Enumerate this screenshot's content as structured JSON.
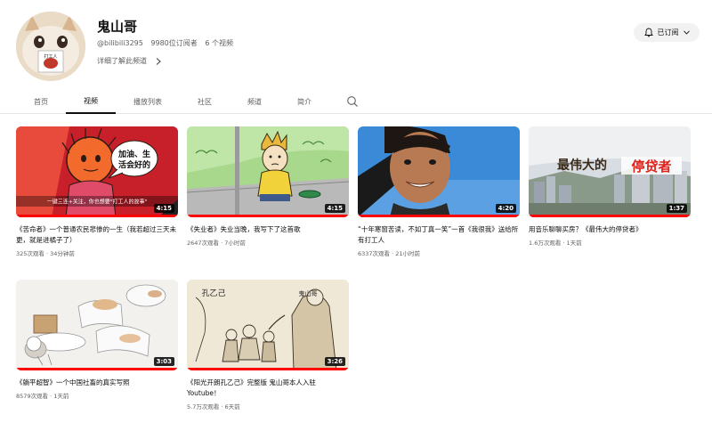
{
  "channel": {
    "name": "鬼山哥",
    "handle": "@bilibili3295",
    "subscribers": "9980位订阅者",
    "video_count": "6 个视频",
    "more_link": "详细了解此频道",
    "subscribe_label": "已订阅",
    "avatar_text": "打工人"
  },
  "tabs": [
    {
      "label": "首页"
    },
    {
      "label": "视频"
    },
    {
      "label": "播放列表"
    },
    {
      "label": "社区"
    },
    {
      "label": "频道"
    },
    {
      "label": "简介"
    }
  ],
  "videos": [
    {
      "title": "《苦命者》一个普通农民悲惨的一生（我若超过三天未更，就是进橘子了）",
      "meta": "325次观看 · 34分钟前",
      "duration": "4:15",
      "progress": 1.0,
      "overlay": {
        "bubble": "加油、生活会好的",
        "caption": "一键三连+关注，你也想要“打工人的故事”"
      }
    },
    {
      "title": "《失业者》失业当晚，我写下了这首歌",
      "meta": "2647次观看 · 7小时前",
      "duration": "4:15",
      "progress": 1.0
    },
    {
      "title": "“十年寒窗苦读，不如丁真一笑”一首《我很我》送给所有打工人",
      "meta": "6337次观看 · 21小时前",
      "duration": "4:20",
      "progress": 1.0
    },
    {
      "title": "用音乐聊聊买房？《最伟大的停贷者》",
      "meta": "1.6万次观看 · 1天前",
      "duration": "1:37",
      "progress": 1.0,
      "overlay": {
        "text_left": "最伟大的",
        "text_right": "停贷者"
      }
    },
    {
      "title": "《躺平超智》一个中国社畜的真实写照",
      "meta": "8579次观看 · 1天前",
      "duration": "3:03",
      "progress": 1.0
    },
    {
      "title": "《阳光开朗孔乙己》完整版 鬼山哥本人入驻Youtube！",
      "meta": "5.7万次观看 · 6天前",
      "duration": "3:26",
      "progress": 1.0,
      "overlay": {
        "text": "孔乙己",
        "author": "鬼山哥"
      }
    }
  ],
  "colors": {
    "accent": "#ff0000",
    "text_primary": "#0f0f0f",
    "text_secondary": "#606060",
    "button_bg": "#f2f2f2"
  },
  "icons": {
    "bell": "bell-icon",
    "chevron": "chevron-right-icon",
    "search": "search-icon"
  }
}
